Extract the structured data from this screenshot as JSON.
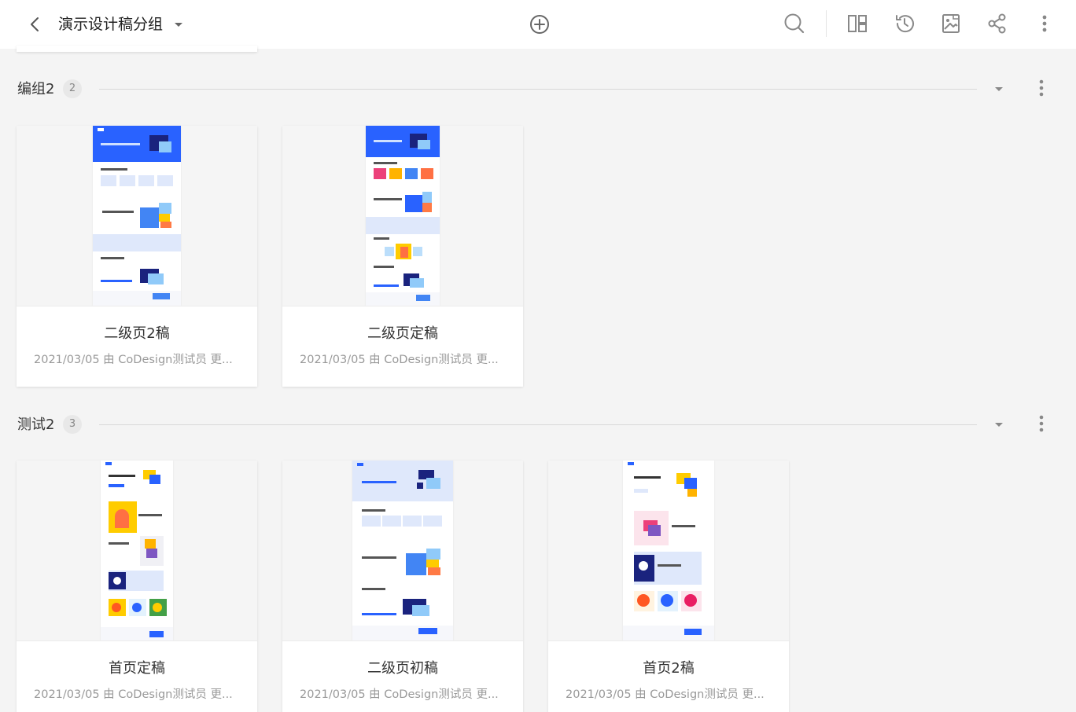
{
  "header": {
    "title": "演示设计稿分组",
    "icons": [
      "back-arrow",
      "chevron-down",
      "add-circle",
      "search",
      "layout-columns",
      "history",
      "image-export",
      "share",
      "more-vertical"
    ]
  },
  "groups": [
    {
      "name": "编组2",
      "count": "2",
      "cards": [
        {
          "name": "二级页2稿",
          "meta": "2021/03/05 由 CoDesign测试员 更..."
        },
        {
          "name": "二级页定稿",
          "meta": "2021/03/05 由 CoDesign测试员 更..."
        }
      ]
    },
    {
      "name": "测试2",
      "count": "3",
      "cards": [
        {
          "name": "首页定稿",
          "meta": "2021/03/05 由 CoDesign测试员 更..."
        },
        {
          "name": "二级页初稿",
          "meta": "2021/03/05 由 CoDesign测试员 更..."
        },
        {
          "name": "首页2稿",
          "meta": "2021/03/05 由 CoDesign测试员 更..."
        }
      ]
    }
  ],
  "colors": {
    "accent_blue": "#2962ff",
    "light_blue": "#dfe8fb",
    "yellow": "#ffcc00",
    "orange": "#ff7a45",
    "background": "#f4f4f4"
  }
}
